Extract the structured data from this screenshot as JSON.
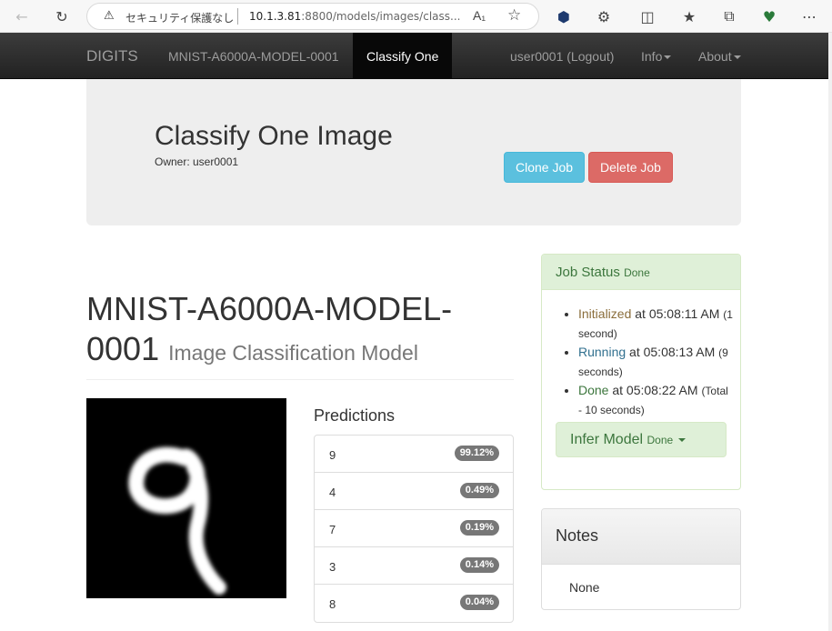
{
  "browser": {
    "security_text": "セキュリティ保護なし",
    "url_host": "10.1.3.81",
    "url_rest": ":8800/models/images/class...",
    "read_aloud": "A͡",
    "icons": [
      "back-arrow-icon",
      "reload-icon",
      "warning-icon",
      "read-aloud-icon",
      "favorite-star-icon",
      "extension-icon",
      "puzzle-icon",
      "split-screen-icon",
      "favorites-icon",
      "collections-icon",
      "browser-essentials-icon",
      "more-icon"
    ]
  },
  "navbar": {
    "brand": "DIGITS",
    "model_link": "MNIST-A6000A-MODEL-0001",
    "active_link": "Classify One",
    "user_link": "user0001 (Logout)",
    "info": "Info",
    "about": "About"
  },
  "jumbotron": {
    "title": "Classify One Image",
    "owner": "Owner: user0001",
    "clone_button": "Clone Job",
    "delete_button": "Delete Job"
  },
  "model": {
    "name": "MNIST-A6000A-MODEL-0001",
    "type": "Image Classification Model"
  },
  "predictions": {
    "heading": "Predictions",
    "items": [
      {
        "label": "9",
        "value": "99.12%"
      },
      {
        "label": "4",
        "value": "0.49%"
      },
      {
        "label": "7",
        "value": "0.19%"
      },
      {
        "label": "3",
        "value": "0.14%"
      },
      {
        "label": "8",
        "value": "0.04%"
      }
    ]
  },
  "job_status": {
    "title": "Job Status",
    "state": "Done",
    "events": [
      {
        "status": "Initialized",
        "at": " at 05:08:11 AM",
        "duration": "(1 second)"
      },
      {
        "status": "Running",
        "at": " at 05:08:13 AM",
        "duration": "(9 seconds)"
      },
      {
        "status": "Done",
        "at": " at 05:08:22 AM",
        "duration": "(Total - 10 seconds)"
      }
    ],
    "infer_button": "Infer Model",
    "infer_state": "Done"
  },
  "notes": {
    "title": "Notes",
    "body": "None"
  },
  "colors": {
    "navbar": "#222222",
    "success_bg": "#dff0d8",
    "success_text": "#3c763d",
    "info_btn": "#5bc0de",
    "danger_btn": "#d9534f",
    "badge": "#777777"
  }
}
